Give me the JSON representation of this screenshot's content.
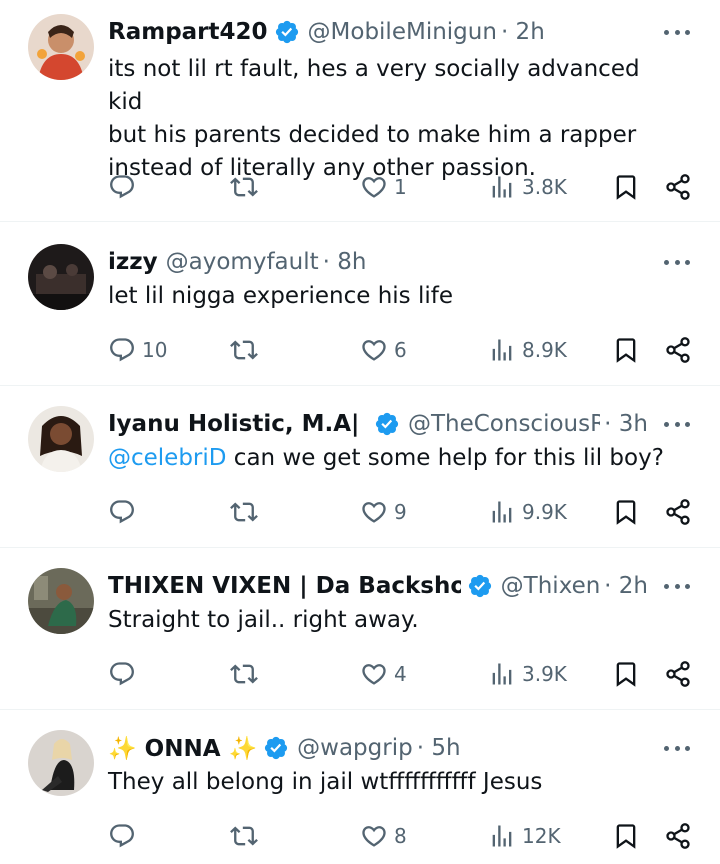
{
  "posts": [
    {
      "name": "Rampart420",
      "handle": "@MobileMinigun",
      "time": "· 2h",
      "verified": true,
      "text": "its not lil rt fault, hes a very socially advanced kid\nbut his parents decided to make him a rapper\ninstead of literally any other passion.",
      "replies": "",
      "likes": "1",
      "views": "3.8K"
    },
    {
      "name": "izzy",
      "handle": "@ayomyfault",
      "time": "· 8h",
      "verified": false,
      "text": "let lil nigga experience his life",
      "replies": "10",
      "likes": "6",
      "views": "8.9K"
    },
    {
      "name": "Iyanu Holistic, M.A| R",
      "handle": "@TheConsciousRI",
      "time": "· 3h",
      "verified": true,
      "mention": "@celebriD",
      "text": " can we get some help for this lil boy?",
      "replies": "",
      "likes": "9",
      "views": "9.9K"
    },
    {
      "name": "THIXEN VIXEN | Da Backshot C",
      "handle": "@Thixen_",
      "time": "· 2h",
      "verified": true,
      "text": "Straight to jail.. right away.",
      "replies": "",
      "likes": "4",
      "views": "3.9K"
    },
    {
      "name": "ONNA",
      "emoji": "✨",
      "handle": "@wapgrip",
      "time": "· 5h",
      "verified": true,
      "text": "They all belong in jail wtfffffffffff Jesus",
      "replies": "",
      "likes": "8",
      "views": "12K"
    }
  ],
  "icons": {
    "reply": "reply-icon",
    "repost": "repost-icon",
    "like": "heart-icon",
    "views": "views-icon",
    "bookmark": "bookmark-icon",
    "share": "share-icon",
    "verified": "verified-badge-icon",
    "more": "more-options-icon"
  },
  "colors": {
    "text": "#0f1419",
    "secondary": "#536471",
    "accent": "#1d9bf0",
    "divider": "#eff3f4"
  }
}
